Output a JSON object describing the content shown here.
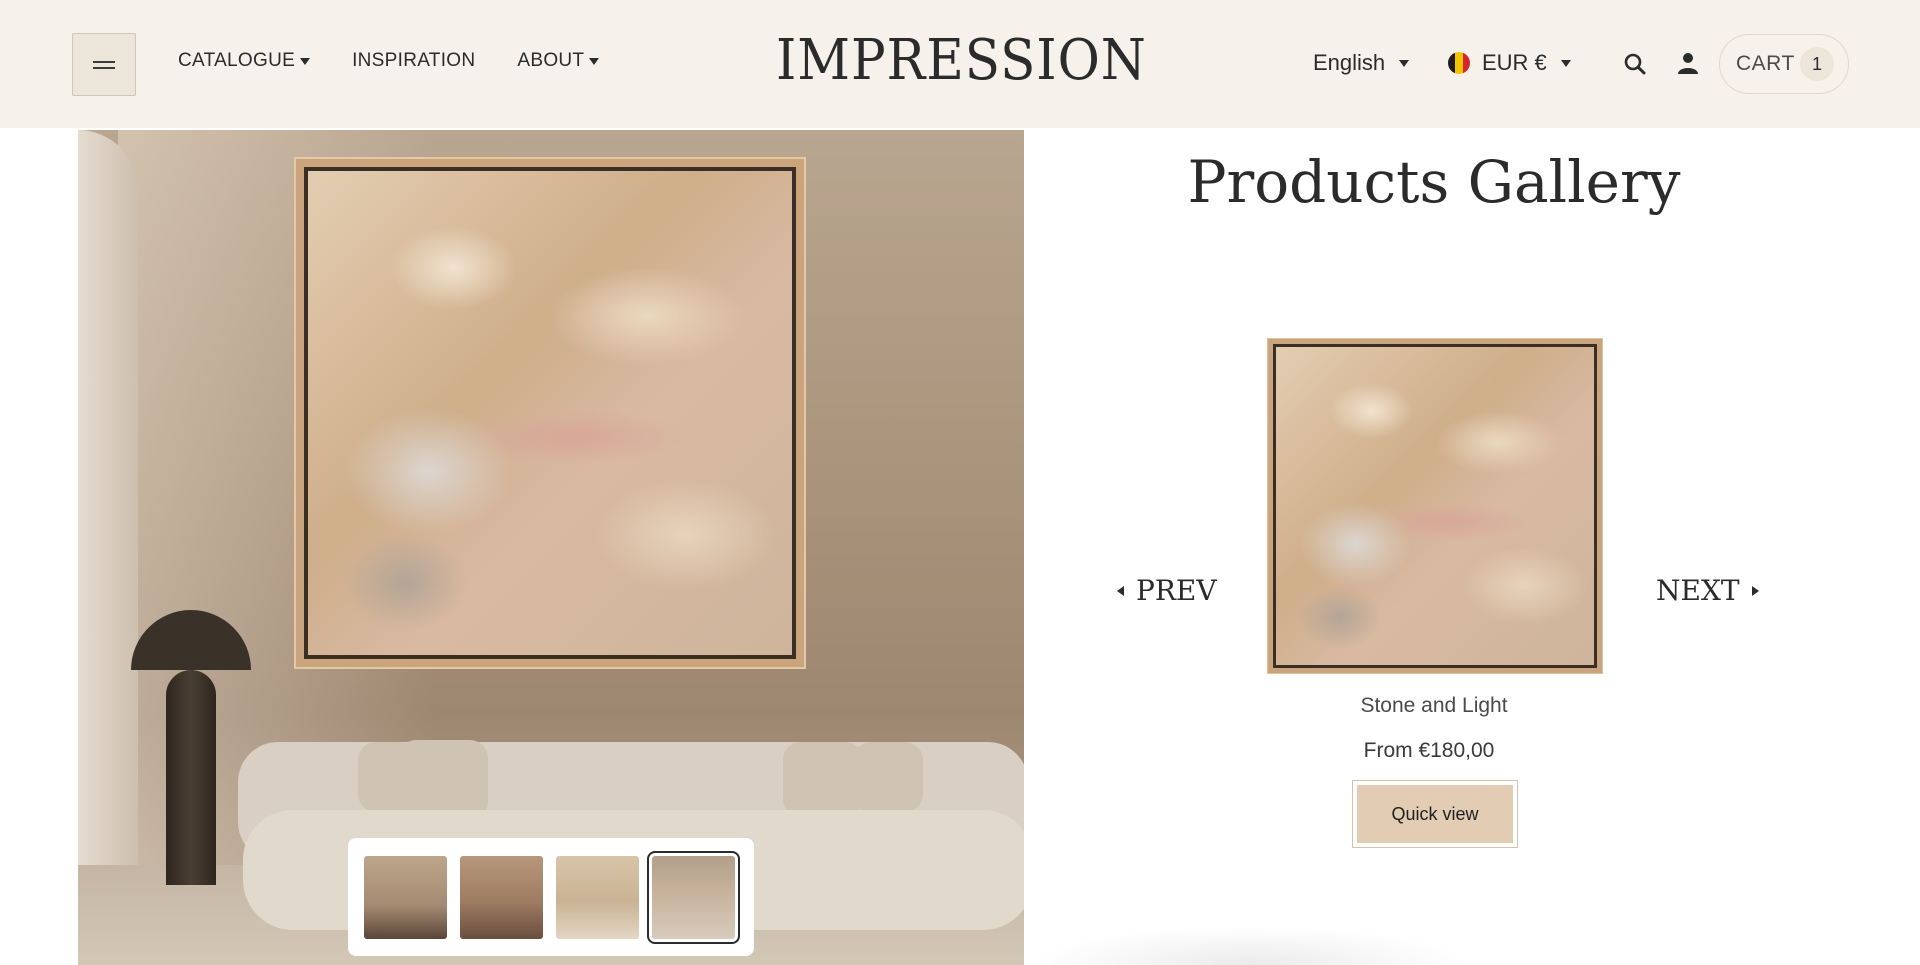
{
  "header": {
    "nav": [
      {
        "label": "CATALOGUE",
        "has_dropdown": true
      },
      {
        "label": "INSPIRATION",
        "has_dropdown": false
      },
      {
        "label": "ABOUT",
        "has_dropdown": true
      }
    ],
    "logo": "IMPRESSION",
    "language": "English",
    "currency": "EUR €",
    "cart_label": "CART",
    "cart_count": "1",
    "icons": {
      "menu": "hamburger-icon",
      "search": "search-icon",
      "account": "user-icon",
      "flag": "belgium-flag-icon"
    }
  },
  "main": {
    "title": "Products Gallery",
    "prev_label": "PREV",
    "next_label": "NEXT",
    "product": {
      "name": "Stone and Light",
      "price": "From €180,00",
      "cta": "Quick view"
    },
    "thumbnails": [
      {
        "name": "room-view-1",
        "active": false
      },
      {
        "name": "room-view-2",
        "active": false
      },
      {
        "name": "room-view-3",
        "active": false
      },
      {
        "name": "room-view-4",
        "active": true
      }
    ]
  },
  "colors": {
    "header_bg": "#f6f1ea",
    "button_bg": "#e2cdb4",
    "text": "#2b2b2b"
  }
}
